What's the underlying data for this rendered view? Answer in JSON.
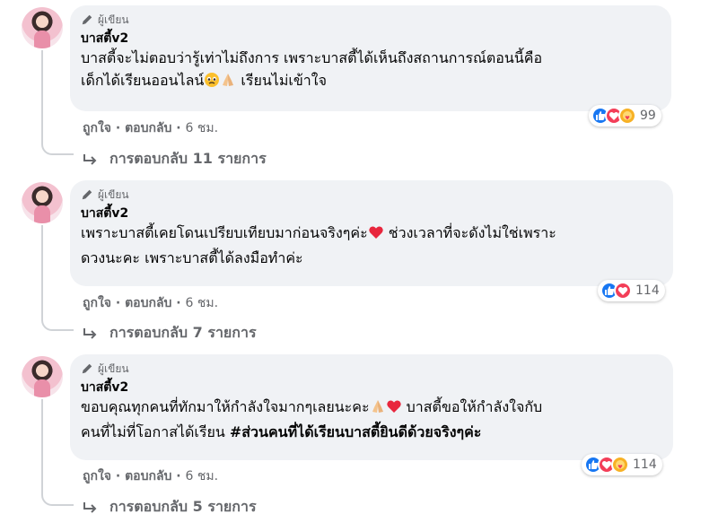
{
  "author_badge_label": "ผู้เขียน",
  "colors": {
    "like": "#1877f2",
    "love": "#f33e58",
    "care": "#f7b125",
    "bubble_bg": "#f0f2f5",
    "meta_text": "#65676b"
  },
  "comments": [
    {
      "author": "บาสตี้v2",
      "line1": "บาสตี้จะไม่ตอบว่ารู้เท่าไม่ถึงการ เพราะบาสตี้ได้เห็นถึงสถานการณ์ตอนนี้คือ",
      "line2a": "เด็กได้เรียนออนไลน์",
      "line2b": " เรียนไม่เข้าใจ",
      "like_label": "ถูกใจ",
      "reply_label": "ตอบกลับ",
      "time": "6 ชม.",
      "reaction_icons": [
        "like-icon",
        "love-icon",
        "care-icon"
      ],
      "reaction_count": "99",
      "replies_label": "การตอบกลับ 11 รายการ"
    },
    {
      "author": "บาสตี้v2",
      "line1a": "เพราะบาสตี้เคยโดนเปรียบเทียบมาก่อนจริงๆค่ะ",
      "line1b": " ช่วงเวลาที่จะดังไม่ใช่เพราะ",
      "line2": "ดวงนะคะ เพราะบาสตี้ได้ลงมือทำค่ะ",
      "like_label": "ถูกใจ",
      "reply_label": "ตอบกลับ",
      "time": "6 ชม.",
      "reaction_icons": [
        "like-icon",
        "love-icon"
      ],
      "reaction_count": "114",
      "replies_label": "การตอบกลับ 7 รายการ"
    },
    {
      "author": "บาสตี้v2",
      "line1a": "ขอบคุณทุกคนที่ทักมาให้กำลังใจมากๆเลยนะคะ",
      "line1b": " บาสตี้ขอให้กำลังใจกับ",
      "line2a": "คนที่ไม่ที่โอกาสได้เรียน ",
      "hashtag": "#ส่วนคนที่ได้เรียนบาสตี้ยินดีด้วยจริงๆค่ะ",
      "like_label": "ถูกใจ",
      "reply_label": "ตอบกลับ",
      "time": "6 ชม.",
      "reaction_icons": [
        "like-icon",
        "love-icon",
        "care-icon"
      ],
      "reaction_count": "114",
      "replies_label": "การตอบกลับ 5 รายการ"
    }
  ]
}
